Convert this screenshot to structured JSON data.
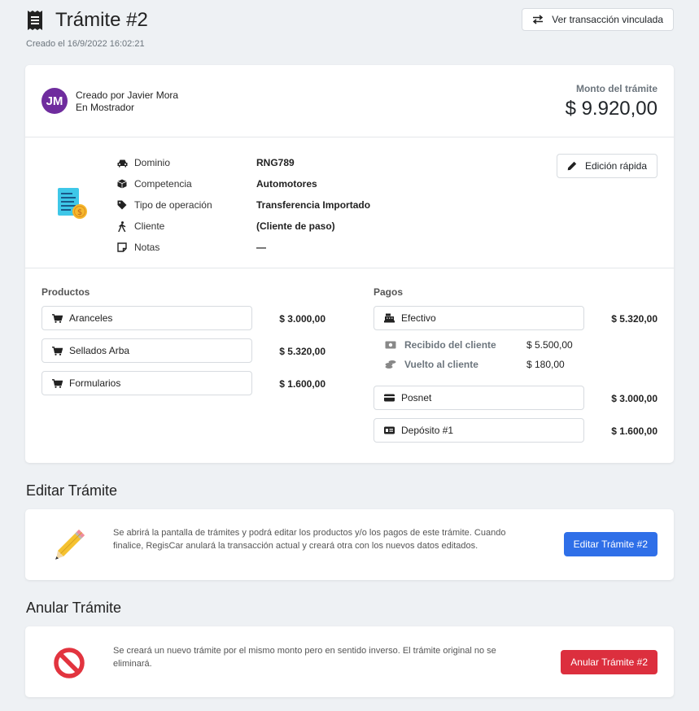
{
  "header": {
    "title": "Trámite #2",
    "created_at": "Creado el 16/9/2022 16:02:21",
    "linked_button": "Ver transacción vinculada"
  },
  "summary": {
    "avatar_initials": "JM",
    "created_by": "Creado por Javier Mora",
    "channel": "En Mostrador",
    "amount_label": "Monto del trámite",
    "amount_value": "$ 9.920,00",
    "accent_color": "#6f2c9e"
  },
  "details": {
    "quick_edit_label": "Edición rápida",
    "rows": [
      {
        "icon": "car-icon",
        "label": "Dominio",
        "value": "RNG789"
      },
      {
        "icon": "cube-icon",
        "label": "Competencia",
        "value": "Automotores"
      },
      {
        "icon": "tag-icon",
        "label": "Tipo de operación",
        "value": "Transferencia Importado"
      },
      {
        "icon": "person-walking-icon",
        "label": "Cliente",
        "value": "(Cliente de paso)"
      },
      {
        "icon": "note-icon",
        "label": "Notas",
        "value": "—"
      }
    ]
  },
  "products": {
    "title": "Productos",
    "items": [
      {
        "label": "Aranceles",
        "price": "$ 3.000,00"
      },
      {
        "label": "Sellados Arba",
        "price": "$ 5.320,00"
      },
      {
        "label": "Formularios",
        "price": "$ 1.600,00"
      }
    ]
  },
  "payments": {
    "title": "Pagos",
    "cash": {
      "label": "Efectivo",
      "price": "$ 5.320,00"
    },
    "received": {
      "label": "Recibido del cliente",
      "value": "$ 5.500,00"
    },
    "change": {
      "label": "Vuelto al cliente",
      "value": "$ 180,00"
    },
    "posnet": {
      "label": "Posnet",
      "price": "$ 3.000,00"
    },
    "deposit": {
      "label": "Depósito #1",
      "price": "$ 1.600,00"
    }
  },
  "edit_section": {
    "heading": "Editar Trámite",
    "text": "Se abrirá la pantalla de trámites y podrá editar los productos y/o los pagos de este trámite. Cuando finalice, RegisCar anulará la transacción actual y creará otra con los nuevos datos editados.",
    "button": "Editar Trámite #2",
    "button_color": "#2f6fe8"
  },
  "cancel_section": {
    "heading": "Anular Trámite",
    "text": "Se creará un nuevo trámite por el mismo monto pero en sentido inverso. El trámite original no se eliminará.",
    "button": "Anular Trámite #2",
    "button_color": "#dc2f3e"
  }
}
